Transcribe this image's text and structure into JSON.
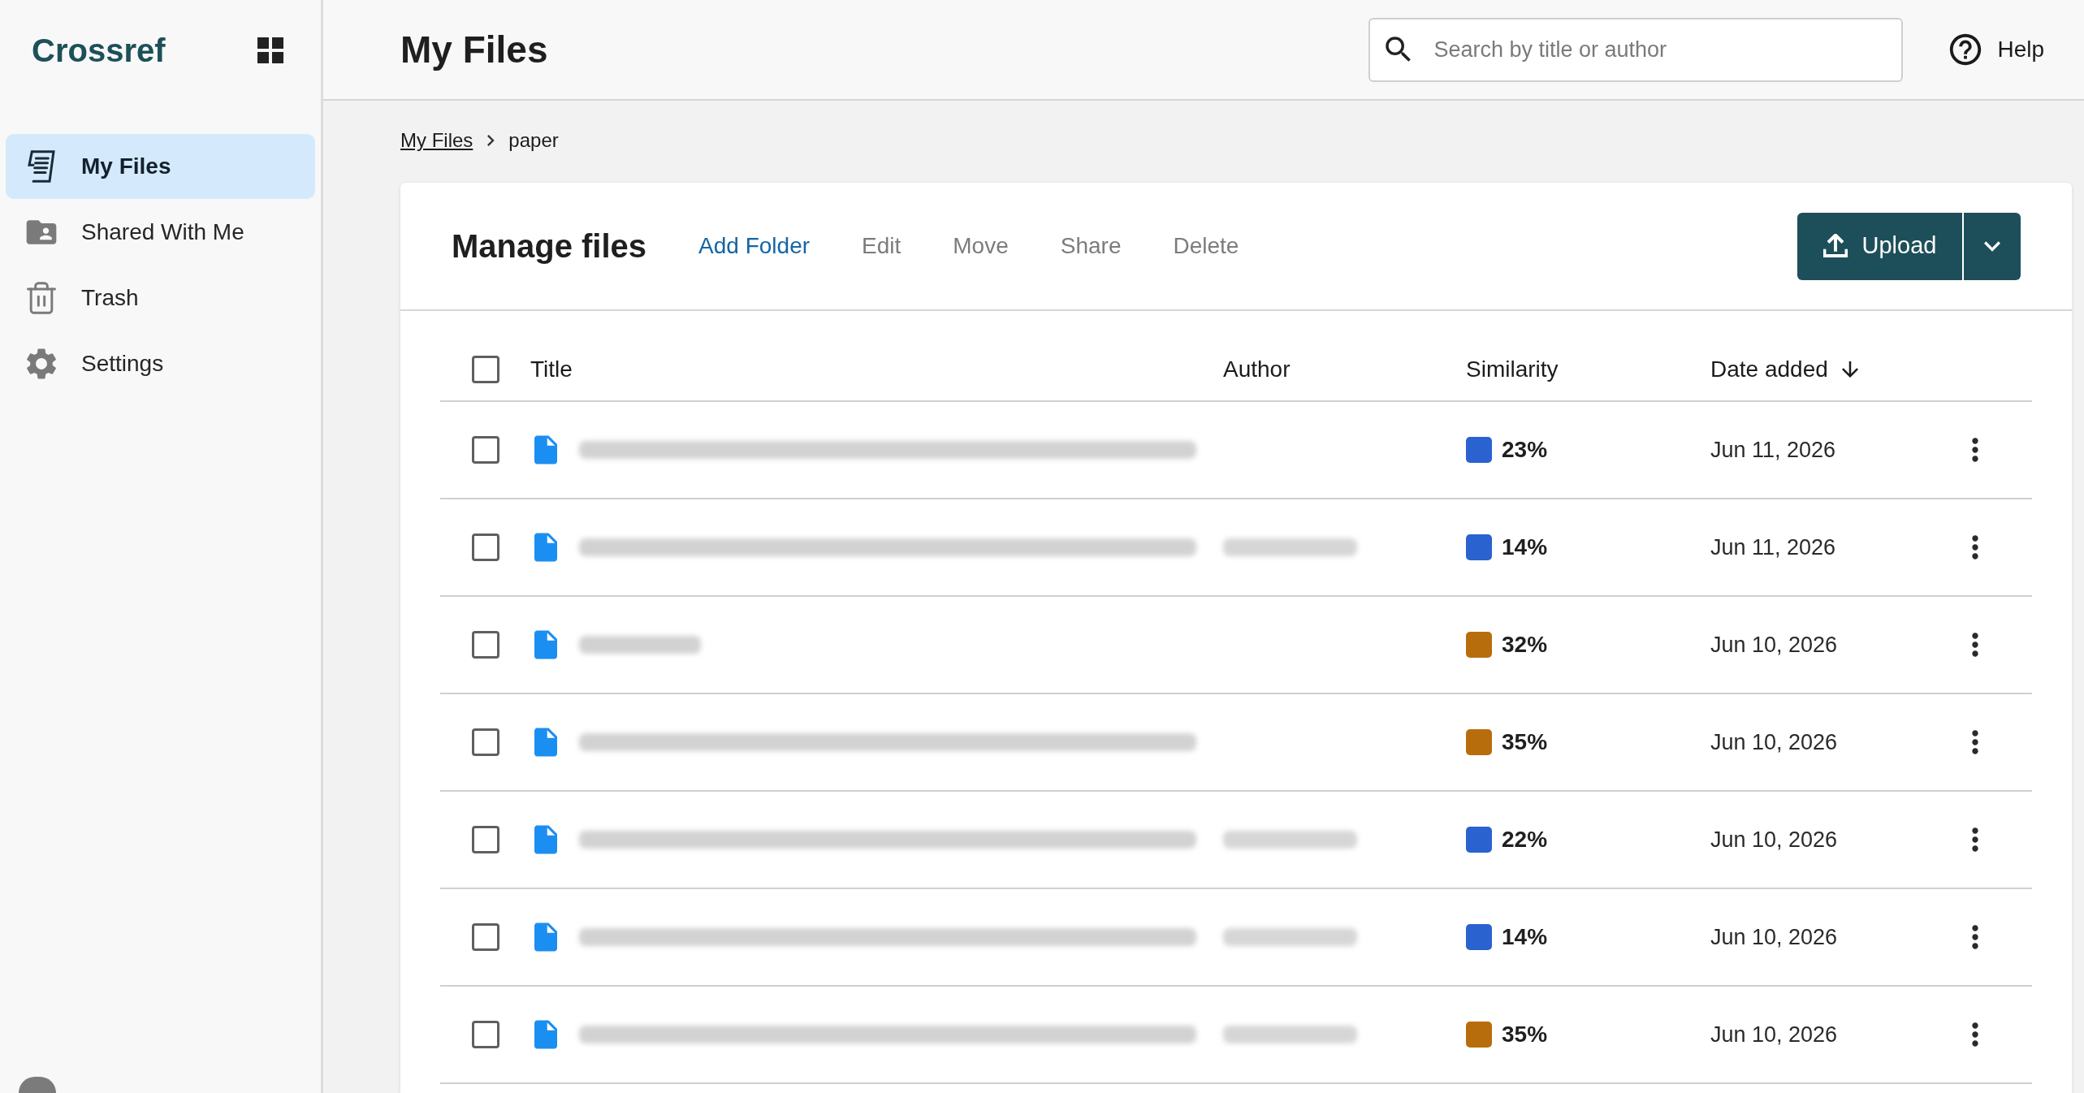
{
  "sidebar": {
    "logo": "Crossref",
    "items": [
      {
        "label": "My Files",
        "selected": true
      },
      {
        "label": "Shared With Me",
        "selected": false
      },
      {
        "label": "Trash",
        "selected": false
      },
      {
        "label": "Settings",
        "selected": false
      }
    ]
  },
  "header": {
    "title": "My Files",
    "search": {
      "placeholder": "Search by title or author"
    },
    "help": "Help"
  },
  "breadcrumb": [
    {
      "label": "My Files",
      "kind": "link"
    },
    {
      "label": "paper",
      "kind": "current"
    }
  ],
  "manage": {
    "title": "Manage files",
    "actions": [
      {
        "label": "Add Folder",
        "disabled": false
      },
      {
        "label": "Edit",
        "disabled": true
      },
      {
        "label": "Move",
        "disabled": true
      },
      {
        "label": "Share",
        "disabled": true
      },
      {
        "label": "Delete",
        "disabled": true
      }
    ],
    "upload": "Upload"
  },
  "table": {
    "select_all": {
      "checked": false
    },
    "columns": [
      {
        "label": "Title",
        "sorted": false
      },
      {
        "label": "Author",
        "sorted": false
      },
      {
        "label": "Similarity",
        "sorted": false
      },
      {
        "label": "Date added",
        "sorted": true
      }
    ],
    "rows": [
      {
        "checked": false,
        "title_short": false,
        "author_blur": false,
        "similarity": "23%",
        "color": "#2a62cf",
        "date": "Jun 11, 2026"
      },
      {
        "checked": false,
        "title_short": false,
        "author_blur": true,
        "similarity": "14%",
        "color": "#2a62cf",
        "date": "Jun 11, 2026"
      },
      {
        "checked": false,
        "title_short": true,
        "author_blur": false,
        "similarity": "32%",
        "color": "#b86d0d",
        "date": "Jun 10, 2026"
      },
      {
        "checked": false,
        "title_short": false,
        "author_blur": false,
        "similarity": "35%",
        "color": "#b86d0d",
        "date": "Jun 10, 2026"
      },
      {
        "checked": false,
        "title_short": false,
        "author_blur": true,
        "similarity": "22%",
        "color": "#2a62cf",
        "date": "Jun 10, 2026"
      },
      {
        "checked": false,
        "title_short": false,
        "author_blur": true,
        "similarity": "14%",
        "color": "#2a62cf",
        "date": "Jun 10, 2026"
      },
      {
        "checked": false,
        "title_short": false,
        "author_blur": true,
        "similarity": "35%",
        "color": "#b86d0d",
        "date": "Jun 10, 2026"
      }
    ]
  }
}
